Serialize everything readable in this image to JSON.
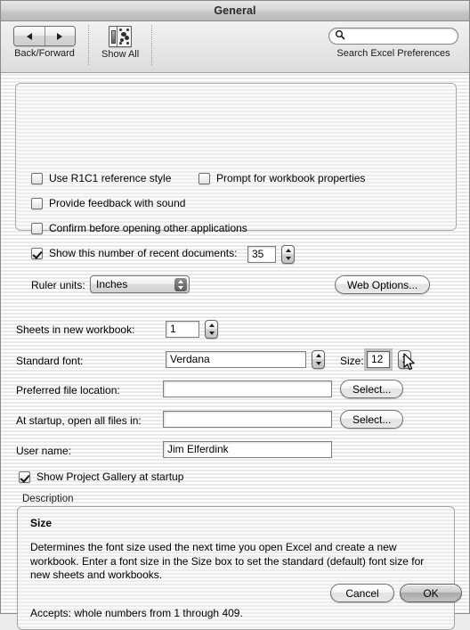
{
  "window": {
    "title": "General"
  },
  "toolbar": {
    "back_forward_label": "Back/Forward",
    "show_all_label": "Show All",
    "search_placeholder": "",
    "search_value": "",
    "search_label": "Search Excel Preferences"
  },
  "settings_group": {
    "use_r1c1": {
      "label": "Use R1C1 reference style",
      "checked": false
    },
    "prompt_workbook_properties": {
      "label": "Prompt for workbook properties",
      "checked": false
    },
    "provide_feedback_sound": {
      "label": "Provide feedback with sound",
      "checked": false
    },
    "confirm_before_opening": {
      "label": "Confirm before opening other applications",
      "checked": false
    },
    "recent_documents": {
      "label": "Show this number of recent documents:",
      "checked": true,
      "value": "35"
    },
    "ruler_units": {
      "label": "Ruler units:",
      "value": "Inches"
    },
    "web_options_button": "Web Options..."
  },
  "fields": {
    "sheets_in_new_workbook": {
      "label": "Sheets in new workbook:",
      "value": "1"
    },
    "standard_font": {
      "label": "Standard font:",
      "value": "Verdana"
    },
    "size": {
      "label": "Size:",
      "value": "12"
    },
    "preferred_file_location": {
      "label": "Preferred file location:",
      "value": "",
      "button": "Select..."
    },
    "at_startup_open_all": {
      "label": "At startup, open all files in:",
      "value": "",
      "button": "Select..."
    },
    "user_name": {
      "label": "User name:",
      "value": "Jim Elferdink"
    },
    "show_project_gallery": {
      "label": "Show Project Gallery at startup",
      "checked": true
    }
  },
  "description": {
    "section_label": "Description",
    "heading": "Size",
    "body": "Determines the font size used the next time you open Excel and create a new workbook. Enter a font size in the Size box to set the standard (default) font size for new sheets and workbooks.",
    "accepts": "Accepts: whole numbers from 1 through 409."
  },
  "footer": {
    "cancel": "Cancel",
    "ok": "OK"
  }
}
